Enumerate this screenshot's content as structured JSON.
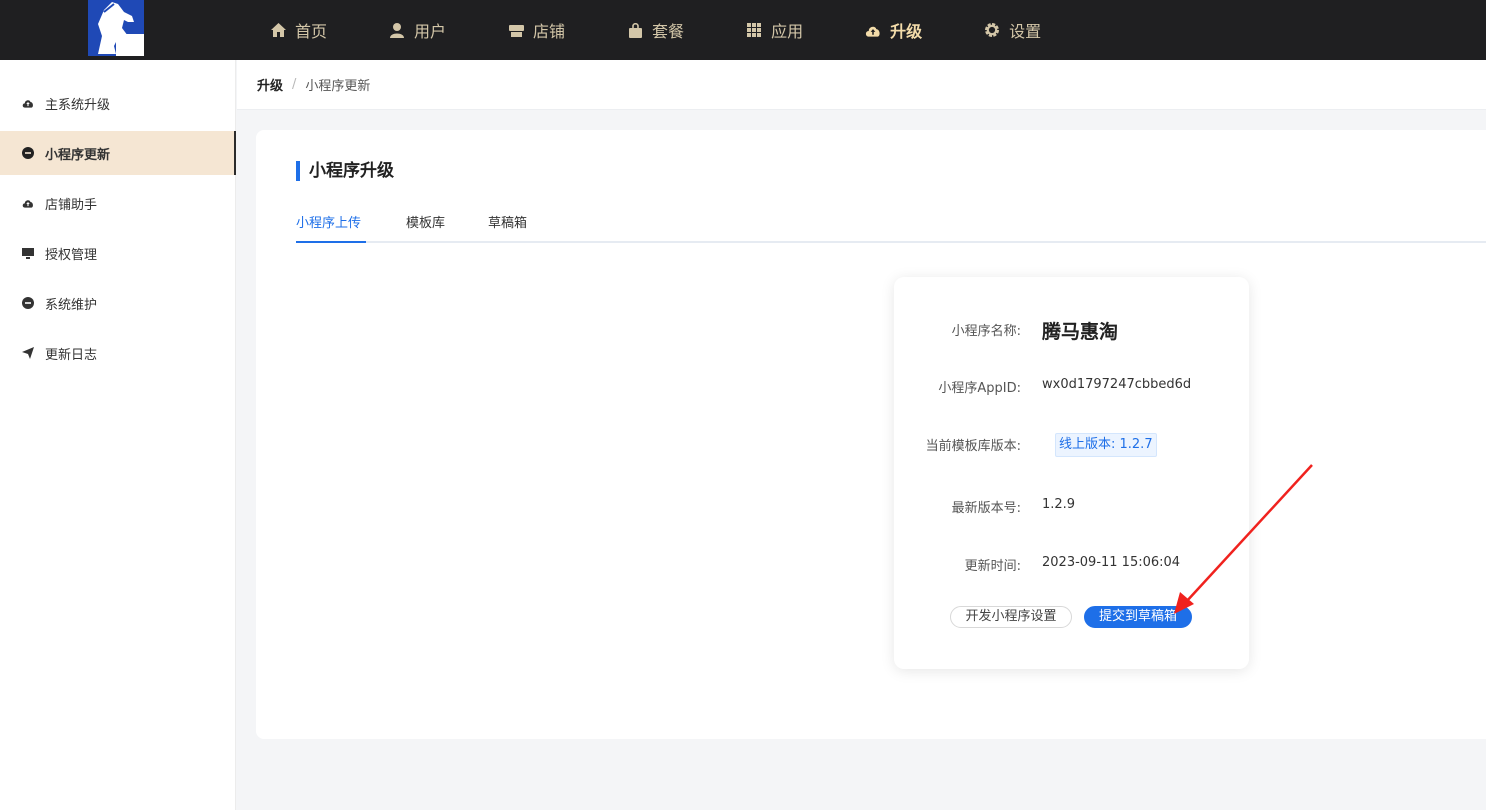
{
  "nav": {
    "items": [
      {
        "label": "首页",
        "icon": "home-icon"
      },
      {
        "label": "用户",
        "icon": "user-icon"
      },
      {
        "label": "店铺",
        "icon": "store-icon"
      },
      {
        "label": "套餐",
        "icon": "bag-icon"
      },
      {
        "label": "应用",
        "icon": "grid-icon"
      },
      {
        "label": "升级",
        "icon": "cloud-upload-icon",
        "active": true
      },
      {
        "label": "设置",
        "icon": "gear-icon"
      }
    ]
  },
  "sidebar": {
    "items": [
      {
        "label": "主系统升级",
        "icon": "cloud-upload-icon"
      },
      {
        "label": "小程序更新",
        "icon": "minus-circle-icon",
        "active": true
      },
      {
        "label": "店铺助手",
        "icon": "cloud-upload-icon"
      },
      {
        "label": "授权管理",
        "icon": "monitor-icon"
      },
      {
        "label": "系统维护",
        "icon": "minus-circle-icon"
      },
      {
        "label": "更新日志",
        "icon": "send-icon"
      }
    ]
  },
  "breadcrumb": {
    "parent": "升级",
    "separator": "/",
    "current": "小程序更新"
  },
  "main": {
    "title": "小程序升级",
    "tabs": [
      {
        "label": "小程序上传",
        "active": true
      },
      {
        "label": "模板库"
      },
      {
        "label": "草稿箱"
      }
    ]
  },
  "panel": {
    "name_label": "小程序名称:",
    "name_value": "腾马惠淘",
    "appid_label": "小程序AppID:",
    "appid_value": "wx0d1797247cbbed6d",
    "template_label": "当前模板库版本:",
    "template_value": "线上版本: 1.2.7",
    "latest_label": "最新版本号:",
    "latest_value": "1.2.9",
    "time_label": "更新时间:",
    "time_value": "2023-09-11 15:06:04",
    "dev_button": "开发小程序设置",
    "submit_button": "提交到草稿箱"
  },
  "colors": {
    "topbar": "#1f1f21",
    "nav_text": "#d3c6a8",
    "accent": "#1e6fe8",
    "sidebar_active": "#f5e6d3",
    "annotation_arrow": "#f0221e"
  }
}
